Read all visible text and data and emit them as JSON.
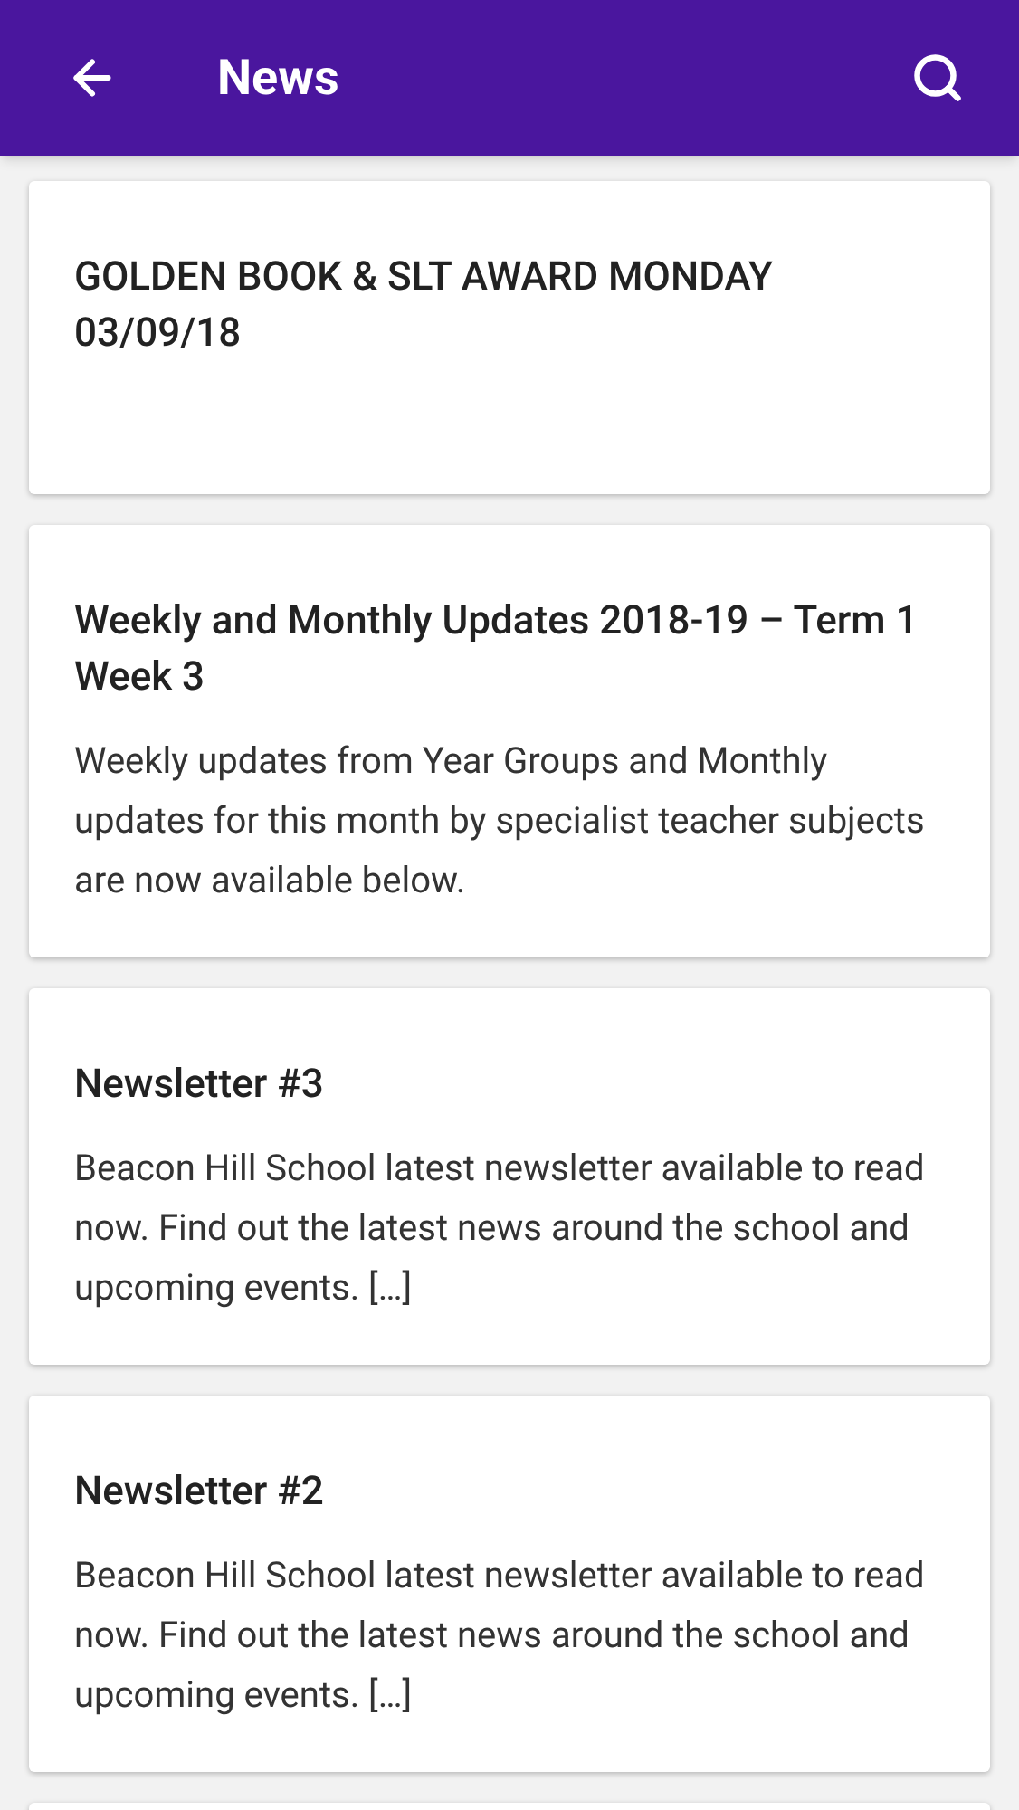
{
  "app_bar": {
    "title": "News"
  },
  "articles": [
    {
      "title": "GOLDEN BOOK & SLT AWARD MONDAY 03/09/18"
    },
    {
      "title": "Weekly and Monthly Updates 2018-19 – Term 1 Week 3",
      "excerpt": "Weekly updates from Year Groups and Monthly updates for this month by specialist teacher subjects are now available below."
    },
    {
      "title": "Newsletter #3",
      "excerpt": "Beacon Hill School latest newsletter available to read now. Find out the latest news around the school and upcoming events. […]"
    },
    {
      "title": "Newsletter #2",
      "excerpt": "Beacon Hill School latest newsletter available to read now. Find out the latest news around the school and upcoming events. […]"
    }
  ]
}
